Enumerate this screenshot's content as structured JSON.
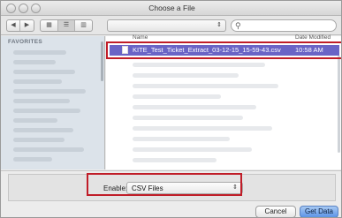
{
  "window": {
    "title": "Choose a File"
  },
  "toolbar": {
    "back_icon": "left-arrow-icon",
    "forward_icon": "right-arrow-icon",
    "view_icons": [
      "icon-view-icon",
      "list-view-icon",
      "column-view-icon"
    ],
    "search_icon": "magnifier-icon"
  },
  "sidebar": {
    "section_title": "FAVORITES"
  },
  "files": {
    "columns": {
      "name": "Name",
      "date": "Date Modified"
    },
    "selected": {
      "name": "KITE_Test_Ticket_Extract_03-12-15_15-59-43.csv",
      "date": "10:58 AM"
    }
  },
  "filter": {
    "label": "Enable:",
    "value": "CSV Files"
  },
  "buttons": {
    "cancel": "Cancel",
    "primary": "Get Data"
  },
  "colors": {
    "selection": "#6a64c6",
    "highlight_box": "#c01d28",
    "primary_button": "#5d94e6"
  }
}
